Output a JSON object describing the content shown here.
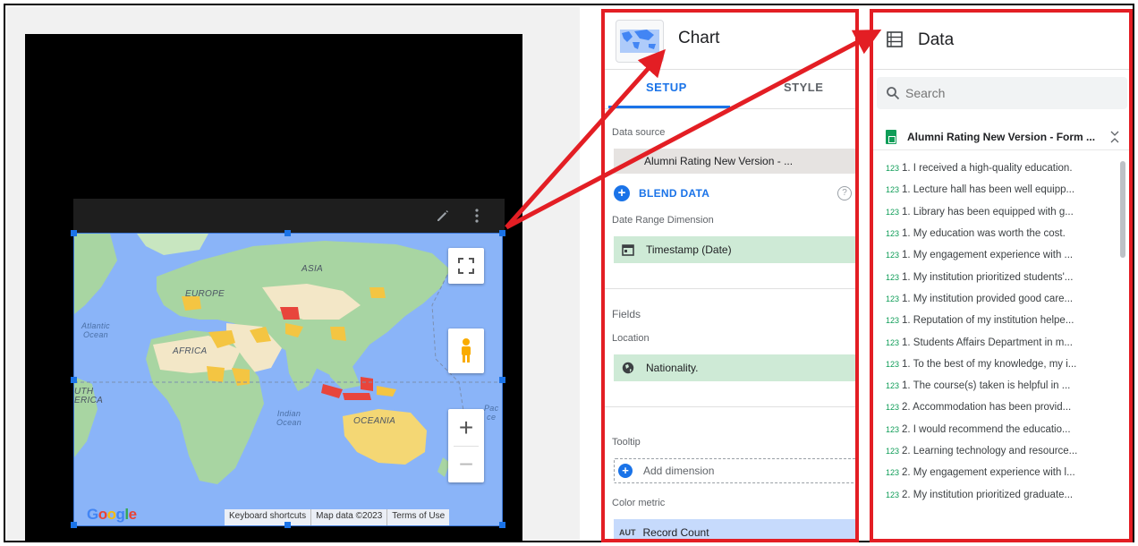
{
  "map": {
    "labels": {
      "asia": "ASIA",
      "europe": "EUROPE",
      "africa": "AFRICA",
      "oceania": "OCEANIA",
      "south_america": "UTH\nERICA",
      "atlantic": "Atlantic\nOcean",
      "indian": "Indian\nOcean",
      "pacific": "Pac\nce"
    },
    "logo": "Google",
    "attribution": [
      "Keyboard shortcuts",
      "Map data ©2023",
      "Terms of Use"
    ],
    "controls": {
      "fullscreen_icon": "fullscreen-icon",
      "pegman_icon": "pegman-icon",
      "zoom_in": "+",
      "zoom_out": "−"
    },
    "toolbar_icons": [
      "edit-icon",
      "more-vert-icon"
    ]
  },
  "chart_panel": {
    "title": "Chart",
    "tabs": [
      "SETUP",
      "STYLE"
    ],
    "active_tab": "SETUP",
    "data_source_label": "Data source",
    "data_source_value": "Alumni Rating New Version - ...",
    "blend_label": "BLEND DATA",
    "help_icon": "?",
    "date_range_label": "Date Range Dimension",
    "date_range_value": "Timestamp (Date)",
    "fields_label": "Fields",
    "location_label": "Location",
    "location_value": "Nationality.",
    "tooltip_label": "Tooltip",
    "add_dimension": "Add dimension",
    "color_metric_label": "Color metric",
    "metric_type": "AUT",
    "metric_value": "Record Count"
  },
  "data_panel": {
    "title": "Data",
    "search_placeholder": "Search",
    "source_name": "Alumni Rating New Version - Form ...",
    "field_type": "123",
    "fields": [
      "1. I received a high-quality education.",
      "1. Lecture hall has been well equipp...",
      "1. Library has been equipped with g...",
      "1. My education was worth the cost.",
      "1. My engagement experience with ...",
      "1. My institution prioritized students'...",
      "1. My institution provided good care...",
      "1. Reputation of my institution helpe...",
      "1. Students Affairs Department in m...",
      "1. To the best of my knowledge, my i...",
      "1. The course(s) taken is helpful in ...",
      "2. Accommodation has been provid...",
      "2. I would recommend the educatio...",
      "2. Learning technology and resource...",
      "2. My engagement experience with l...",
      "2. My institution prioritized graduate..."
    ]
  },
  "colors": {
    "highlight_border": "#e31e24",
    "accent_blue": "#1a73e8",
    "dimension_green": "#ceead6",
    "metric_blue": "#c6dafc",
    "ocean": "#8ab4f8",
    "land": "#a8d5a2",
    "data_low": "#f4c542",
    "data_high": "#e8453c"
  }
}
